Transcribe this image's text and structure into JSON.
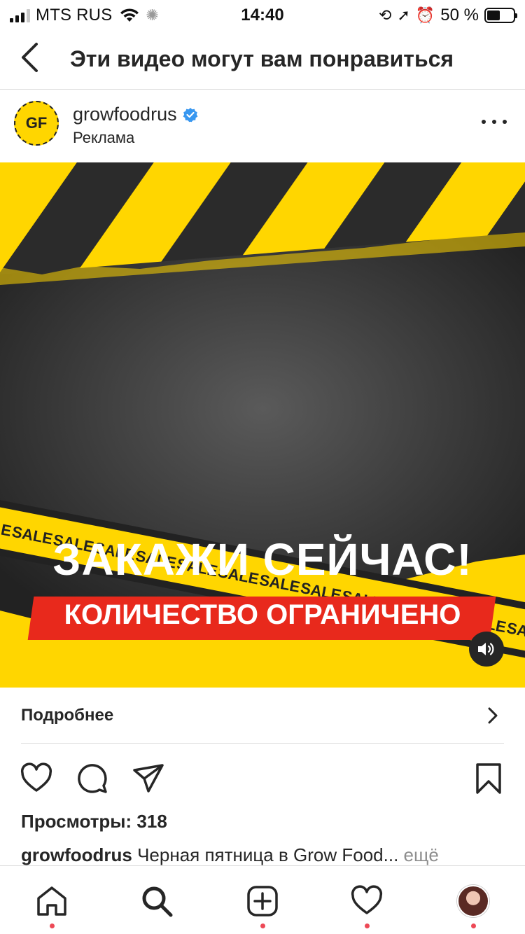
{
  "status_bar": {
    "carrier": "MTS RUS",
    "time": "14:40",
    "battery": "50 %",
    "battery_level": 0.5
  },
  "header": {
    "title": "Эти видео могут вам понравиться"
  },
  "post": {
    "avatar_text": "GF",
    "username": "growfoodrus",
    "sponsored": "Реклама",
    "media": {
      "headline": "ЗАКАЖИ СЕЙЧАС!",
      "subhead": "КОЛИЧЕСТВО ОГРАНИЧЕНО",
      "tape_word": "SALE"
    },
    "cta": "Подробнее",
    "views": "Просмотры: 318",
    "caption_user": "growfoodrus",
    "caption_text": " Черная пятница в Grow Food...",
    "caption_more": " ещё"
  },
  "colors": {
    "brand_yellow": "#ffd600",
    "dark_gray": "#2b2b2b",
    "sale_red": "#e8291c",
    "verified_blue": "#3897f0",
    "notify_red": "#ed4956"
  },
  "icons": {
    "back": "chevron-left-icon",
    "more": "more-horizontal-icon",
    "like": "heart-icon",
    "comment": "comment-icon",
    "share": "send-icon",
    "save": "bookmark-icon",
    "home": "home-icon",
    "search": "search-icon",
    "create": "plus-square-icon",
    "activity": "heart-icon",
    "profile": "avatar"
  }
}
